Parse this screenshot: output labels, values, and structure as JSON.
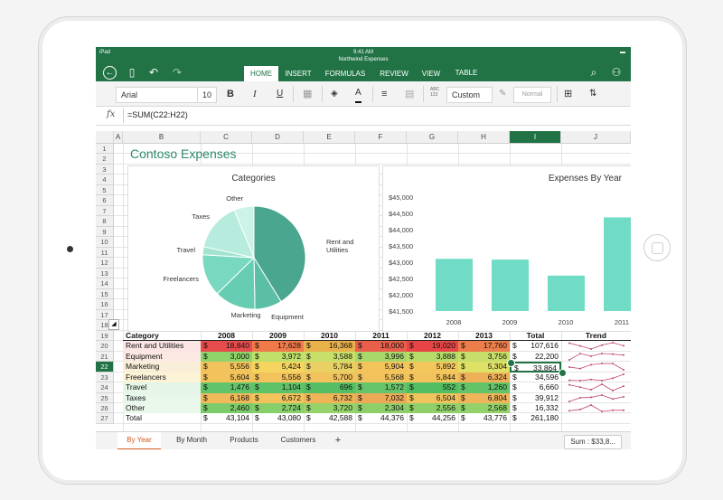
{
  "status": {
    "device": "iPad",
    "time": "9:41 AM",
    "filename": "Northwind Expenses"
  },
  "tabs": [
    "HOME",
    "INSERT",
    "FORMULAS",
    "REVIEW",
    "VIEW",
    "TABLE"
  ],
  "toolbar": {
    "font": "Arial",
    "size": "10",
    "bold": "B",
    "italic": "I",
    "underline": "U",
    "abc": "ABC\n123",
    "number_format": "Custom",
    "style": "Normal"
  },
  "formula": {
    "fx": "fx",
    "text": "=SUM(C22:H22)"
  },
  "columns": [
    "A",
    "B",
    "C",
    "D",
    "E",
    "F",
    "G",
    "H",
    "I",
    "J"
  ],
  "rows": [
    "1",
    "2",
    "3",
    "4",
    "5",
    "6",
    "7",
    "8",
    "9",
    "10",
    "11",
    "12",
    "13",
    "14",
    "15",
    "16",
    "17",
    "18",
    "19",
    "20",
    "21",
    "22",
    "23",
    "24",
    "25",
    "26",
    "27"
  ],
  "sheet_title": "Contoso Expenses",
  "table": {
    "headers": [
      "Category",
      "2008",
      "2009",
      "2010",
      "2011",
      "2012",
      "2013",
      "Total",
      "Trend"
    ],
    "rows": [
      {
        "cat": "Rent and Utilities",
        "vals": [
          "18,840",
          "17,628",
          "16,368",
          "18,000",
          "19,020",
          "17,760"
        ],
        "total": "107,616"
      },
      {
        "cat": "Equipment",
        "vals": [
          "3,000",
          "3,972",
          "3,588",
          "3,996",
          "3,888",
          "3,756"
        ],
        "total": "22,200"
      },
      {
        "cat": "Marketing",
        "vals": [
          "5,556",
          "5,424",
          "5,784",
          "5,904",
          "5,892",
          "5,304"
        ],
        "total": "33,864"
      },
      {
        "cat": "Freelancers",
        "vals": [
          "5,604",
          "5,556",
          "5,700",
          "5,568",
          "5,844",
          "6,324"
        ],
        "total": "34,596"
      },
      {
        "cat": "Travel",
        "vals": [
          "1,476",
          "1,104",
          "696",
          "1,572",
          "552",
          "1,260"
        ],
        "total": "6,660"
      },
      {
        "cat": "Taxes",
        "vals": [
          "6,168",
          "6,672",
          "6,732",
          "7,032",
          "6,504",
          "6,804"
        ],
        "total": "39,912"
      },
      {
        "cat": "Other",
        "vals": [
          "2,460",
          "2,724",
          "3,720",
          "2,304",
          "2,556",
          "2,568"
        ],
        "total": "16,332"
      },
      {
        "cat": "Total",
        "vals": [
          "43,104",
          "43,080",
          "42,588",
          "44,376",
          "44,256",
          "43,776"
        ],
        "total": "261,180"
      }
    ]
  },
  "sheet_tabs": [
    "By Year",
    "By Month",
    "Products",
    "Customers",
    "+"
  ],
  "sum_label": "Sum : $33,8...",
  "chart_data": [
    {
      "type": "pie",
      "title": "Categories",
      "categories": [
        "Rent and Utilities",
        "Equipment",
        "Marketing",
        "Freelancers",
        "Travel",
        "Taxes",
        "Other"
      ],
      "values": [
        107616,
        22200,
        33864,
        34596,
        6660,
        39912,
        16332
      ],
      "colors": [
        "#4aa68f",
        "#5bbfa6",
        "#66cdb2",
        "#78d9c0",
        "#a3e3d2",
        "#b6ebdd",
        "#cdf2e8"
      ]
    },
    {
      "type": "bar",
      "title": "Expenses By Year",
      "categories": [
        "2008",
        "2009",
        "2010",
        "2011"
      ],
      "values": [
        43104,
        43080,
        42588,
        44376
      ],
      "ylim": [
        41500,
        45000
      ],
      "yticks": [
        "$41,500",
        "$42,000",
        "$42,500",
        "$43,000",
        "$43,500",
        "$44,000",
        "$44,500",
        "$45,000"
      ],
      "color": "#70dcc6"
    }
  ]
}
